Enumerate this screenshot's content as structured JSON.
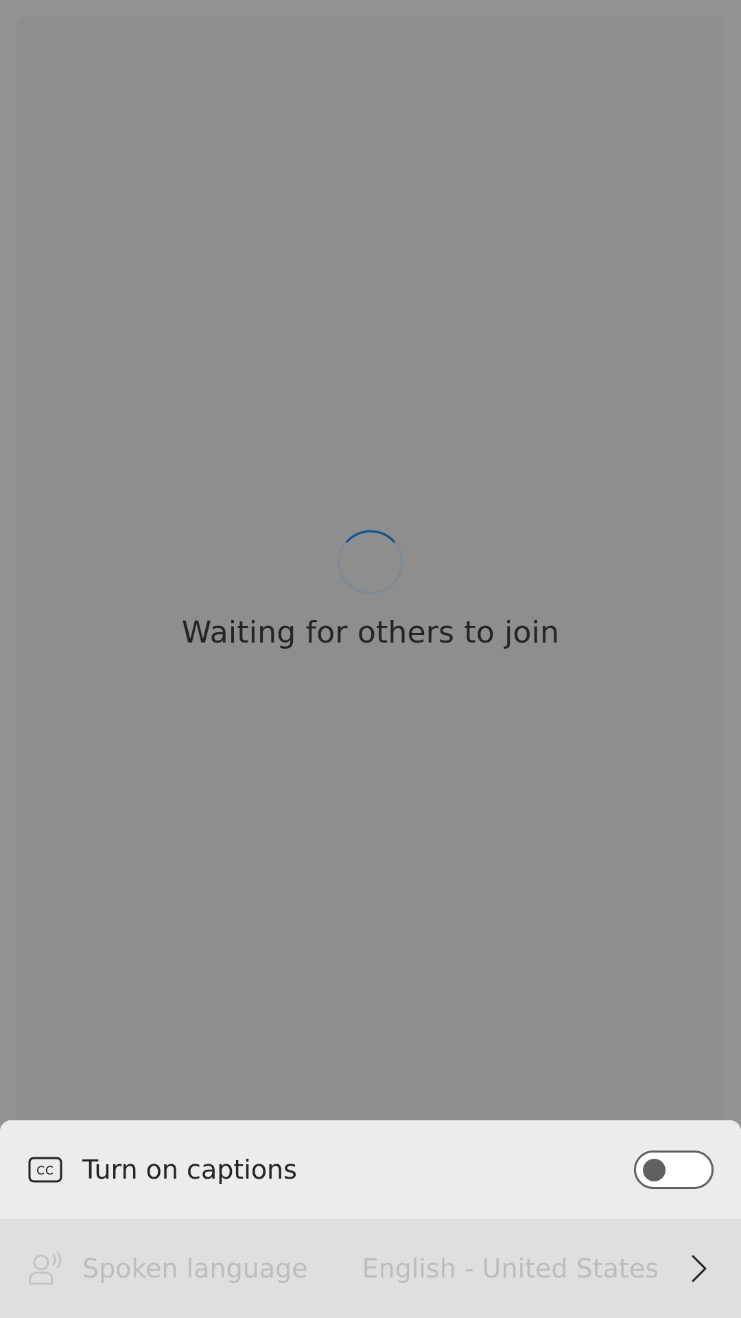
{
  "status": {
    "message": "Waiting for others to join",
    "spinner_icon": "loading-spinner-icon",
    "spinner_color": "#0f548c"
  },
  "captions": {
    "icon": "closed-captions-icon",
    "label": "Turn on captions",
    "enabled": false
  },
  "spoken_language": {
    "icon": "person-voice-icon",
    "label": "Spoken language",
    "value": "English - United States",
    "chevron": "chevron-right-icon"
  }
}
